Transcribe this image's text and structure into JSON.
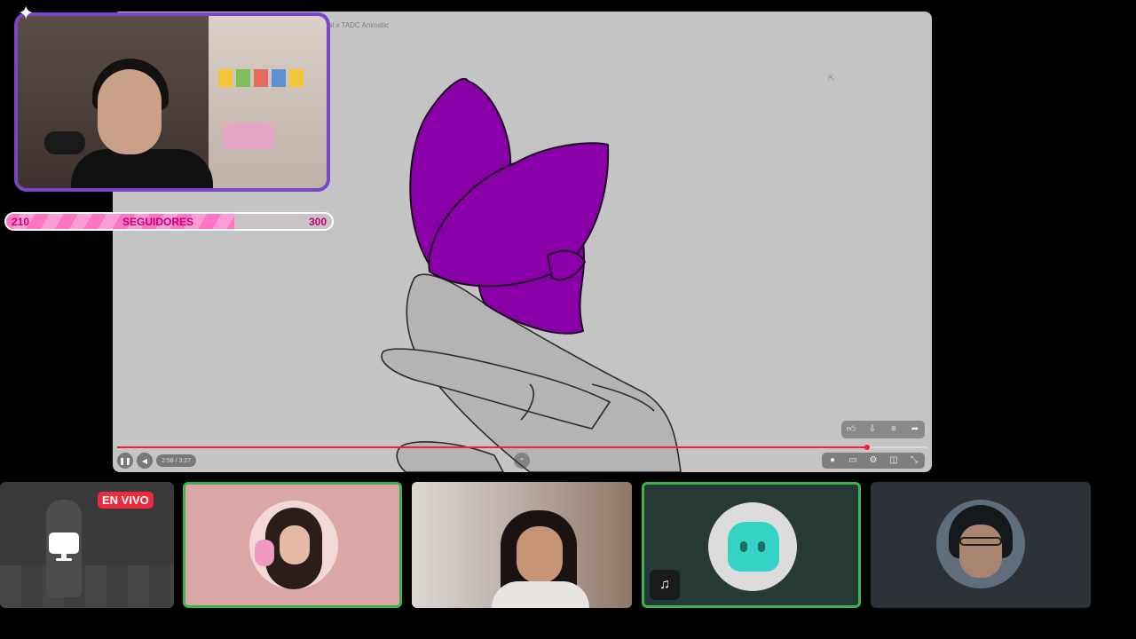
{
  "video": {
    "title": "al x TADC Animatic",
    "time": "2:58 / 3:27",
    "progress": 0.926,
    "top_controls": [
      "thumbs-up-icon",
      "thumbs-down-icon",
      "playlist-add-icon",
      "share-icon"
    ],
    "bottom_controls": [
      "autoplay-toggle-icon",
      "subtitles-icon",
      "settings-icon",
      "cast-icon",
      "collapse-icon"
    ]
  },
  "follower_goal": {
    "current": "210",
    "label": "SEGUIDORES",
    "goal": "300",
    "progress": 0.7
  },
  "participants": {
    "live_badge": "EN VIVO"
  },
  "colors": {
    "butterfly": "#8a00a8",
    "webcam_border": "#7b45c9",
    "progress": "#ff1744",
    "speaking_border": "#3bb34f",
    "live_red": "#ed2b3d",
    "follower_pink": "#ff74c5"
  }
}
